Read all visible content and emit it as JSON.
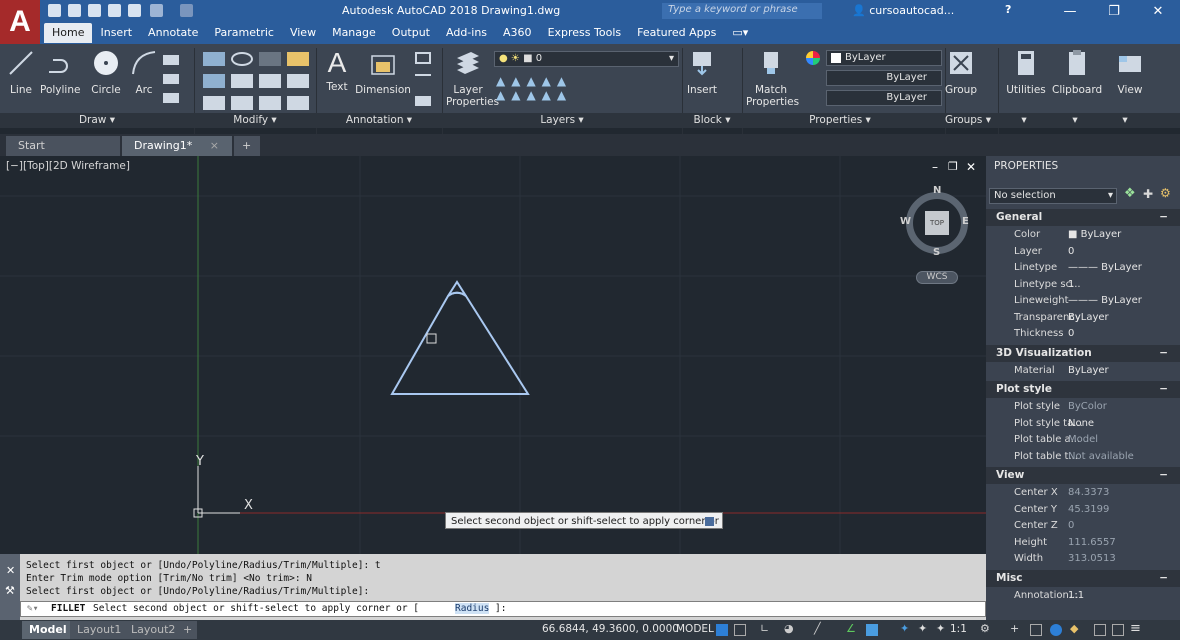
{
  "app": {
    "logo": "A",
    "title": "Autodesk AutoCAD 2018   Drawing1.dwg",
    "search_placeholder": "Type a keyword or phrase",
    "user": "cursoautocad...",
    "help": "?"
  },
  "ribbon_tabs": [
    "Home",
    "Insert",
    "Annotate",
    "Parametric",
    "View",
    "Manage",
    "Output",
    "Add-ins",
    "A360",
    "Express Tools",
    "Featured Apps"
  ],
  "tools": {
    "line": "Line",
    "polyline": "Polyline",
    "circle": "Circle",
    "arc": "Arc",
    "text": "Text",
    "dimension": "Dimension",
    "layer_properties": "Layer Properties",
    "layer_value": "0",
    "insert": "Insert",
    "match_properties": "Match Properties",
    "bylayer1": "ByLayer",
    "bylayer2": "ByLayer",
    "bylayer3": "ByLayer",
    "group": "Group",
    "utilities": "Utilities",
    "clipboard": "Clipboard",
    "view": "View"
  },
  "panels": {
    "draw": "Draw ▾",
    "modify": "Modify ▾",
    "annotation": "Annotation ▾",
    "layers": "Layers ▾",
    "block": "Block ▾",
    "properties": "Properties ▾",
    "groups": "Groups ▾"
  },
  "doc_tabs": {
    "start": "Start",
    "drawing": "Drawing1*"
  },
  "viewport": {
    "label": "[−][Top][2D Wireframe]",
    "tooltip": "Select second object or shift-select to apply corner or",
    "compass": {
      "n": "N",
      "s": "S",
      "e": "E",
      "w": "W",
      "top": "TOP",
      "wcs": "WCS"
    },
    "axis_x": "X",
    "axis_y": "Y"
  },
  "properties": {
    "title": "PROPERTIES",
    "selection": "No selection",
    "general": {
      "head": "General",
      "rows": [
        [
          "Color",
          "■ ByLayer"
        ],
        [
          "Layer",
          "0"
        ],
        [
          "Linetype",
          "——— ByLayer"
        ],
        [
          "Linetype sc...",
          "1"
        ],
        [
          "Lineweight",
          "——— ByLayer"
        ],
        [
          "Transparency",
          "ByLayer"
        ],
        [
          "Thickness",
          "0"
        ]
      ]
    },
    "viz": {
      "head": "3D Visualization",
      "rows": [
        [
          "Material",
          "ByLayer"
        ]
      ]
    },
    "plot": {
      "head": "Plot style",
      "rows": [
        [
          "Plot style",
          "ByColor"
        ],
        [
          "Plot style ta...",
          "None"
        ],
        [
          "Plot table a...",
          "Model"
        ],
        [
          "Plot table t...",
          "Not available"
        ]
      ]
    },
    "view": {
      "head": "View",
      "rows": [
        [
          "Center X",
          "84.3373"
        ],
        [
          "Center Y",
          "45.3199"
        ],
        [
          "Center Z",
          "0"
        ],
        [
          "Height",
          "111.6557"
        ],
        [
          "Width",
          "313.0513"
        ]
      ]
    },
    "misc": {
      "head": "Misc",
      "rows": [
        [
          "Annotation...",
          "1:1"
        ]
      ]
    }
  },
  "command": {
    "lines": [
      "Select first object or [Undo/Polyline/Radius/Trim/Multiple]: t",
      "Enter Trim mode option [Trim/No trim] <No trim>: N",
      "Select first object or [Undo/Polyline/Radius/Trim/Multiple]:"
    ],
    "input_cmd": "FILLET",
    "input_text": "Select second object or shift-select to apply corner or [",
    "input_option": "Radius",
    "input_end": "]:"
  },
  "status": {
    "model_tab": "Model",
    "layout1": "Layout1",
    "layout2": "Layout2",
    "coords": "66.6844, 49.3600, 0.0000",
    "model": "MODEL",
    "scale": "1:1"
  }
}
